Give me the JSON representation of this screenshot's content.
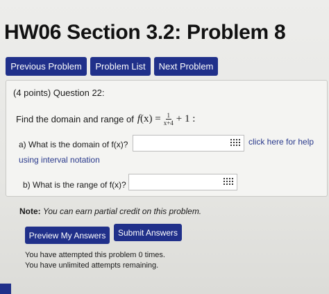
{
  "header": {
    "title": "HW06 Section 3.2: Problem 8"
  },
  "nav": {
    "previous_problem": "Previous Problem",
    "problem_list": "Problem List",
    "next_problem": "Next Problem"
  },
  "question": {
    "points_label": "(4 points) Question 22:",
    "find_text": "Find the domain and range of",
    "function_lhs": "f",
    "function_var": "(x) =",
    "fraction_numerator": "1",
    "fraction_denominator": "x+4",
    "function_tail": "+ 1 :"
  },
  "part_a": {
    "label": "a) What is the domain of f(x)?",
    "value": "",
    "help_link": "click here for help",
    "interval_link": "using interval notation"
  },
  "part_b": {
    "label": "b) What is the range of f(x)?",
    "value": ""
  },
  "note": {
    "bold": "Note:",
    "text": "You can earn partial credit on this problem."
  },
  "actions": {
    "preview": "Preview My Answers",
    "submit": "Submit Answers"
  },
  "status": {
    "attempted": "You have attempted this problem 0 times.",
    "remaining": "You have unlimited attempts remaining."
  },
  "colors": {
    "button_bg": "#20308a",
    "link": "#2a3a8c"
  },
  "icons": {
    "keyboard": "equation-editor-icon"
  }
}
